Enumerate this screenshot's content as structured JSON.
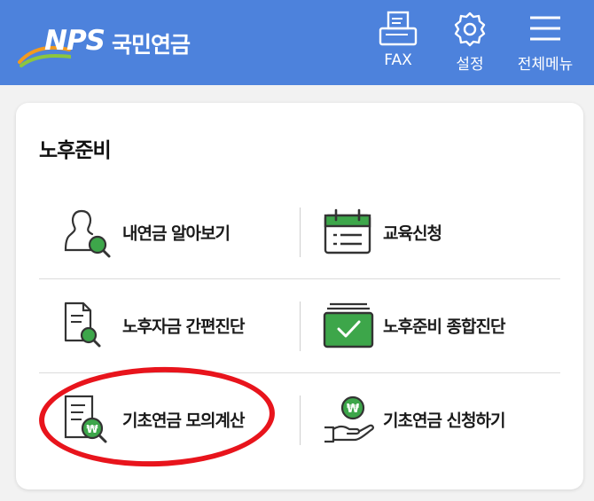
{
  "header": {
    "logo_abbr": "NPS",
    "logo_text": "국민연금",
    "buttons": [
      {
        "label": "FAX",
        "icon": "fax-icon"
      },
      {
        "label": "설정",
        "icon": "gear-icon"
      },
      {
        "label": "전체메뉴",
        "icon": "hamburger-menu-icon"
      }
    ]
  },
  "card": {
    "title": "노후준비",
    "items": [
      {
        "label": "내연금 알아보기",
        "icon": "person-search-icon"
      },
      {
        "label": "교육신청",
        "icon": "calendar-icon"
      },
      {
        "label": "노후자금 간편진단",
        "icon": "document-search-icon"
      },
      {
        "label": "노후준비 종합진단",
        "icon": "checkbox-stack-icon"
      },
      {
        "label": "기초연금 모의계산",
        "icon": "document-won-icon"
      },
      {
        "label": "기초연금 신청하기",
        "icon": "hand-coin-icon"
      }
    ]
  },
  "colors": {
    "header_bg": "#4d82dc",
    "icon_green": "#3da64a",
    "highlight_red": "#e8141c"
  }
}
